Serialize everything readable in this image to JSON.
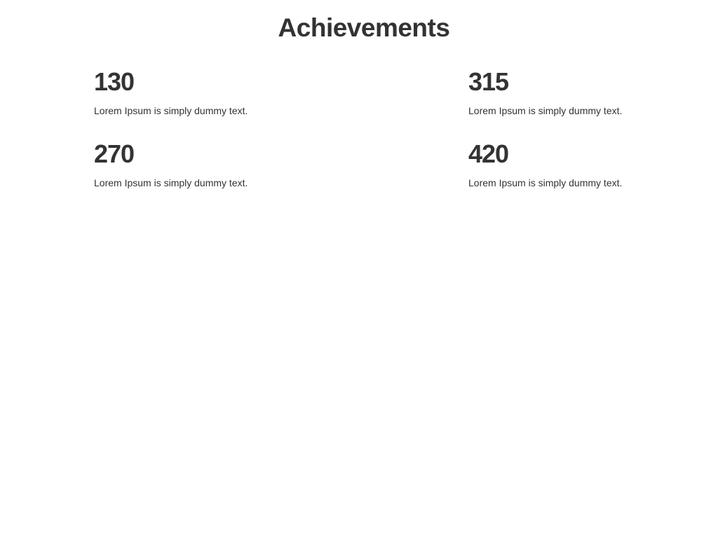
{
  "section": {
    "title": "Achievements"
  },
  "stats": [
    {
      "value": "130",
      "description": "Lorem Ipsum is simply dummy text."
    },
    {
      "value": "315",
      "description": "Lorem Ipsum is simply dummy text."
    },
    {
      "value": "270",
      "description": "Lorem Ipsum is simply dummy text."
    },
    {
      "value": "420",
      "description": "Lorem Ipsum is simply dummy text."
    }
  ]
}
